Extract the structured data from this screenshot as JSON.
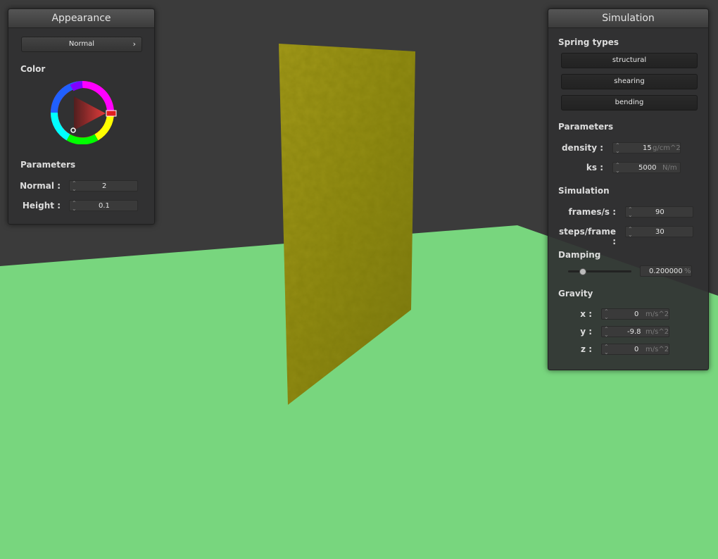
{
  "appearance": {
    "title": "Appearance",
    "mode_button": "Normal",
    "color_label": "Color",
    "parameters_label": "Parameters",
    "normal_label": "Normal :",
    "normal_value": "2",
    "height_label": "Height :",
    "height_value": "0.1"
  },
  "simulation": {
    "title": "Simulation",
    "spring_types_label": "Spring types",
    "spring_types": [
      "structural",
      "shearing",
      "bending"
    ],
    "parameters_label": "Parameters",
    "density_label": "density :",
    "density_value": "15",
    "density_unit": "g/cm^2",
    "ks_label": "ks :",
    "ks_value": "5000",
    "ks_unit": "N/m",
    "simulation_label": "Simulation",
    "fps_label": "frames/s :",
    "fps_value": "90",
    "steps_label": "steps/frame :",
    "steps_value": "30",
    "damping_label": "Damping",
    "damping_value": "0.200000",
    "damping_unit": "%",
    "damping_level": 0.2,
    "gravity_label": "Gravity",
    "gx_label": "x :",
    "gx_value": "0",
    "gy_label": "y :",
    "gy_value": "-9.8",
    "gz_label": "z :",
    "gz_value": "0",
    "gravity_unit": "m/s^2"
  },
  "colors": {
    "background": "#3b3b3b",
    "floor": "#78d67e",
    "cloth": "#8a8a1c",
    "panel": "#303032"
  }
}
